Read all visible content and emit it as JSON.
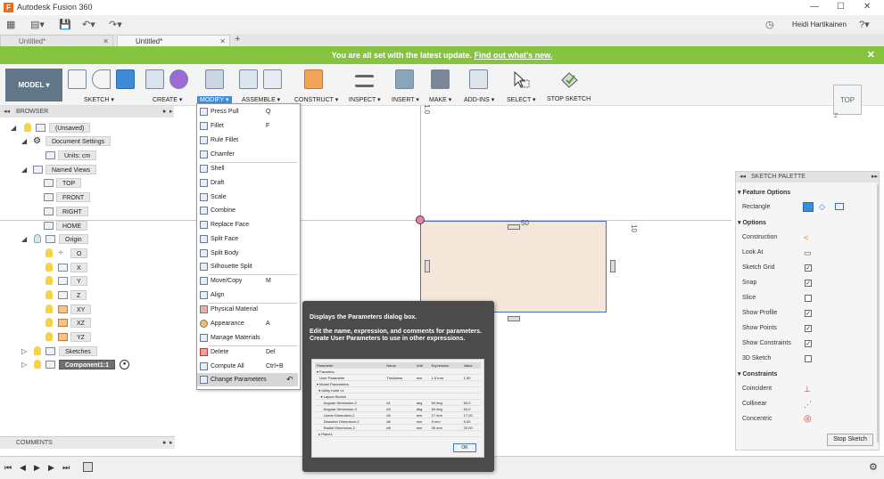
{
  "app": {
    "title": "Autodesk Fusion 360",
    "logo": "F"
  },
  "window": {
    "minimize": "—",
    "restore": "☐",
    "close": "✕"
  },
  "qat": {
    "user": "Heidi Hartikainen",
    "help": "?",
    "clock": "◷"
  },
  "tabs": [
    {
      "label": "Untitled*",
      "active": false
    },
    {
      "label": "Untitled*",
      "active": true
    }
  ],
  "update_bar": {
    "text": "You are all set with the latest update.",
    "link": "Find out what's new.",
    "close": "✕"
  },
  "toolbar": {
    "model": "MODEL ▾",
    "groups": [
      "SKETCH ▾",
      "CREATE ▾",
      "MODIFY ▾",
      "ASSEMBLE ▾",
      "CONSTRUCT ▾",
      "INSPECT ▾",
      "INSERT ▾",
      "MAKE ▾",
      "ADD-INS ▾",
      "SELECT ▾",
      "STOP SKETCH"
    ]
  },
  "viewcube": {
    "face": "TOP",
    "axis": "Z"
  },
  "browser": {
    "header": "BROWSER",
    "items": [
      {
        "label": "(Unsaved)"
      },
      {
        "label": "Document Settings"
      },
      {
        "label": "Units: cm"
      },
      {
        "label": "Named Views"
      },
      {
        "label": "TOP"
      },
      {
        "label": "FRONT"
      },
      {
        "label": "RIGHT"
      },
      {
        "label": "HOME"
      },
      {
        "label": "Origin"
      },
      {
        "label": "O"
      },
      {
        "label": "X"
      },
      {
        "label": "Y"
      },
      {
        "label": "Z"
      },
      {
        "label": "XY"
      },
      {
        "label": "XZ"
      },
      {
        "label": "YZ"
      },
      {
        "label": "Sketches"
      },
      {
        "label": "Component1:1"
      }
    ]
  },
  "comments": {
    "label": "COMMENTS"
  },
  "canvas": {
    "dim_top": "50",
    "dim_right": "10",
    "dim_v": "1.0"
  },
  "modify_menu": [
    {
      "label": "Press Pull",
      "key": "Q"
    },
    {
      "label": "Fillet",
      "key": "F"
    },
    {
      "label": "Rule Fillet",
      "key": ""
    },
    {
      "label": "Chamfer",
      "key": ""
    },
    {
      "label": "Shell",
      "key": ""
    },
    {
      "label": "Draft",
      "key": ""
    },
    {
      "label": "Scale",
      "key": ""
    },
    {
      "label": "Combine",
      "key": ""
    },
    {
      "label": "Replace Face",
      "key": ""
    },
    {
      "label": "Split Face",
      "key": ""
    },
    {
      "label": "Split Body",
      "key": ""
    },
    {
      "label": "Silhouette Split",
      "key": ""
    },
    {
      "label": "Move/Copy",
      "key": "M"
    },
    {
      "label": "Align",
      "key": ""
    },
    {
      "label": "Physical Material",
      "key": ""
    },
    {
      "label": "Appearance",
      "key": "A"
    },
    {
      "label": "Manage Materials",
      "key": ""
    },
    {
      "label": "Delete",
      "key": "Del"
    },
    {
      "label": "Compute All",
      "key": "Ctrl+B"
    },
    {
      "label": "Change Parameters",
      "key": ""
    }
  ],
  "tooltip": {
    "title": "Displays the Parameters dialog box.",
    "body": "Edit the name, expression, and comments for parameters. Create User Parameters to use in other expressions.",
    "table_headers": [
      "Parameter",
      "Name",
      "Unit",
      "Expression",
      "Value"
    ],
    "table_rows": [
      [
        "▾ Favorites",
        "",
        "",
        "",
        ""
      ],
      [
        "   User Parameter",
        "Thickness",
        "mm",
        "1.5 mm",
        "1.50"
      ],
      [
        "▾ Model Parameters",
        "",
        "",
        "",
        ""
      ],
      [
        "  ▾ Utility Knife v1",
        "",
        "",
        "",
        ""
      ],
      [
        "    ▾ Layout Sketch",
        "",
        "",
        "",
        ""
      ],
      [
        "       Angular Dimension-2",
        "d1",
        "deg",
        "63 deg",
        "63.0"
      ],
      [
        "       Angular Dimension-3",
        "d3",
        "deg",
        "54 deg",
        "54.0"
      ],
      [
        "       Linear Dimension-2",
        "d5",
        "mm",
        "17 mm",
        "17.00"
      ],
      [
        "       Diameter Dimension-2",
        "d6",
        "mm",
        "5 mm",
        "5.00"
      ],
      [
        "       Radial Dimension-2",
        "d8",
        "mm",
        "20 mm",
        "20.00"
      ],
      [
        "  ▸ Plane1",
        "",
        "",
        "",
        ""
      ]
    ],
    "ok": "OK"
  },
  "sketch_palette": {
    "header": "SKETCH PALETTE",
    "feature_options": "Feature Options",
    "rectangle": "Rectangle",
    "options": "Options",
    "rows": [
      {
        "label": "Construction",
        "type": "icon",
        "icon": "<"
      },
      {
        "label": "Look At",
        "type": "icon",
        "icon": "▭"
      },
      {
        "label": "Sketch Grid",
        "type": "check",
        "checked": "✓"
      },
      {
        "label": "Snap",
        "type": "check",
        "checked": "✓"
      },
      {
        "label": "Slice",
        "type": "check",
        "checked": ""
      },
      {
        "label": "Show Profile",
        "type": "check",
        "checked": "✓"
      },
      {
        "label": "Show Points",
        "type": "check",
        "checked": "✓"
      },
      {
        "label": "Show Constraints",
        "type": "check",
        "checked": "✓"
      },
      {
        "label": "3D Sketch",
        "type": "check",
        "checked": ""
      }
    ],
    "constraints": "Constraints",
    "constraint_rows": [
      {
        "label": "Coincident",
        "icon": "⊥"
      },
      {
        "label": "Collinear",
        "icon": "⋰"
      },
      {
        "label": "Concentric",
        "icon": "◎"
      }
    ],
    "stop": "Stop Sketch"
  },
  "colors": {
    "update_green": "#86c440",
    "accent_blue": "#3d8ed9"
  }
}
